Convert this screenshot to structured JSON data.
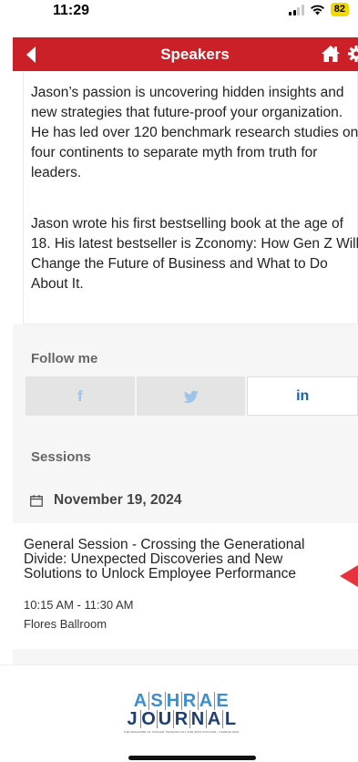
{
  "status_bar": {
    "time": "11:29",
    "battery": "82"
  },
  "nav": {
    "title": "Speakers",
    "back_icon": "back-arrow-icon",
    "home_icon": "home-icon",
    "settings_icon": "gear-icon",
    "bar_color": "#cc2028"
  },
  "bio": {
    "paragraphs": [
      "Jason’s passion is uncovering hidden insights and new strategies that future-proof your organization. He has led over 120 benchmark research studies on four continents to separate myth from truth for leaders.",
      "Jason wrote his first bestselling book at the age of 18. His latest bestseller is Zconomy: How Gen Z Will Change the Future of Business and What to Do About It."
    ]
  },
  "follow": {
    "label": "Follow me",
    "facebook": "f",
    "twitter_icon": "twitter-bird-icon",
    "linkedin": "in"
  },
  "sessions": {
    "label": "Sessions",
    "date": "November 19, 2024",
    "items": [
      {
        "title": "General Session - Crossing the Generational Divide: Unexpected Discoveries and New Solutions to Unlock Employee Performance",
        "time": "10:15 AM - 11:30 AM",
        "room": "Flores Ballroom"
      }
    ]
  },
  "footer": {
    "logo_top": "ASHRAE",
    "logo_bottom": "JOURNAL",
    "logo_tagline": "THE MAGAZINE OF HVAC&R TECHNOLOGY AND APPLICATIONS • ASHRAE.ORG"
  }
}
